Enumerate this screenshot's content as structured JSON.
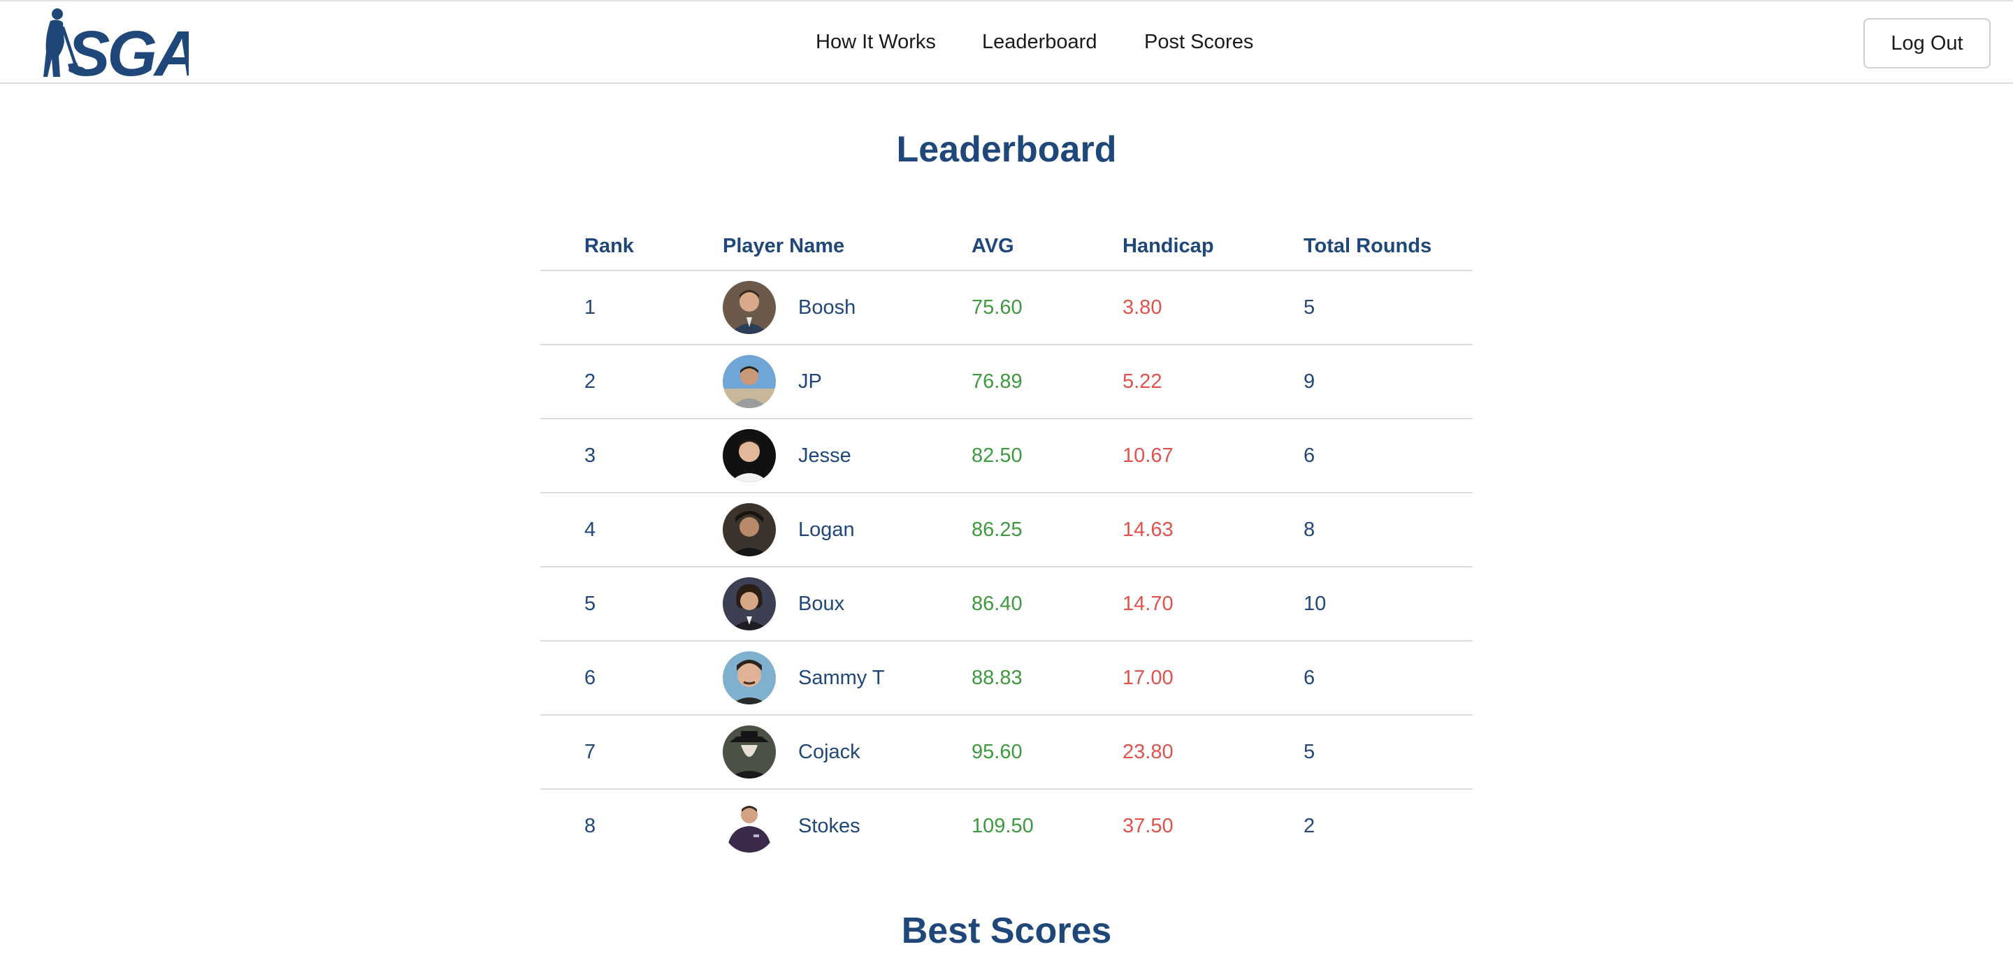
{
  "header": {
    "logo_text": "SGA",
    "nav": [
      {
        "label": "How It Works"
      },
      {
        "label": "Leaderboard"
      },
      {
        "label": "Post Scores"
      }
    ],
    "logout_label": "Log Out"
  },
  "leaderboard": {
    "title": "Leaderboard",
    "columns": [
      "Rank",
      "Player Name",
      "AVG",
      "Handicap",
      "Total Rounds"
    ],
    "rows": [
      {
        "rank": "1",
        "name": "Boosh",
        "avg": "75.60",
        "handicap": "3.80",
        "rounds": "5"
      },
      {
        "rank": "2",
        "name": "JP",
        "avg": "76.89",
        "handicap": "5.22",
        "rounds": "9"
      },
      {
        "rank": "3",
        "name": "Jesse",
        "avg": "82.50",
        "handicap": "10.67",
        "rounds": "6"
      },
      {
        "rank": "4",
        "name": "Logan",
        "avg": "86.25",
        "handicap": "14.63",
        "rounds": "8"
      },
      {
        "rank": "5",
        "name": "Boux",
        "avg": "86.40",
        "handicap": "14.70",
        "rounds": "10"
      },
      {
        "rank": "6",
        "name": "Sammy T",
        "avg": "88.83",
        "handicap": "17.00",
        "rounds": "6"
      },
      {
        "rank": "7",
        "name": "Cojack",
        "avg": "95.60",
        "handicap": "23.80",
        "rounds": "5"
      },
      {
        "rank": "8",
        "name": "Stokes",
        "avg": "109.50",
        "handicap": "37.50",
        "rounds": "2"
      }
    ]
  },
  "best_scores": {
    "title": "Best Scores"
  },
  "colors": {
    "brand_navy": "#1f4779",
    "avg_green": "#3d9a3f",
    "handicap_red": "#e0524c"
  }
}
